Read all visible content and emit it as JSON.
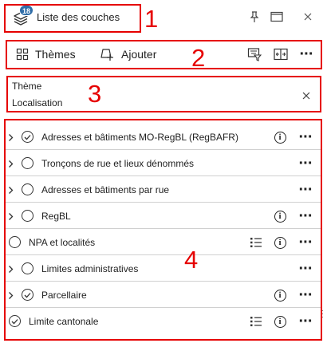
{
  "header": {
    "badge_count": "18",
    "title": "Liste des couches",
    "icons": [
      "layers-icon",
      "pin-icon",
      "maximize-icon",
      "close-icon"
    ]
  },
  "toolbar": {
    "themes_label": "Thèmes",
    "add_label": "Ajouter",
    "icons": [
      "grid-icon",
      "add-layer-icon",
      "filter-icon",
      "compare-icon",
      "more-icon"
    ]
  },
  "theme": {
    "label": "Thème",
    "value": "Localisation"
  },
  "annotations": [
    "1",
    "2",
    "3",
    "4"
  ],
  "layers": [
    {
      "name": "Adresses et bâtiments MO-RegBL (RegBAFR)",
      "expandable": true,
      "checked": true,
      "info": true,
      "legend": false
    },
    {
      "name": "Tronçons de rue et lieux dénommés",
      "expandable": true,
      "checked": false,
      "info": false,
      "legend": false
    },
    {
      "name": "Adresses et bâtiments par rue",
      "expandable": true,
      "checked": false,
      "info": false,
      "legend": false
    },
    {
      "name": "RegBL",
      "expandable": true,
      "checked": false,
      "info": true,
      "legend": false
    },
    {
      "name": "NPA et localités",
      "expandable": false,
      "checked": false,
      "info": true,
      "legend": true
    },
    {
      "name": "Limites administratives",
      "expandable": true,
      "checked": false,
      "info": false,
      "legend": false
    },
    {
      "name": "Parcellaire",
      "expandable": true,
      "checked": true,
      "info": true,
      "legend": false
    },
    {
      "name": "Limite cantonale",
      "expandable": false,
      "checked": true,
      "info": true,
      "legend": true
    }
  ],
  "colors": {
    "annotation": "#e60000",
    "badge": "#2f6da8"
  }
}
